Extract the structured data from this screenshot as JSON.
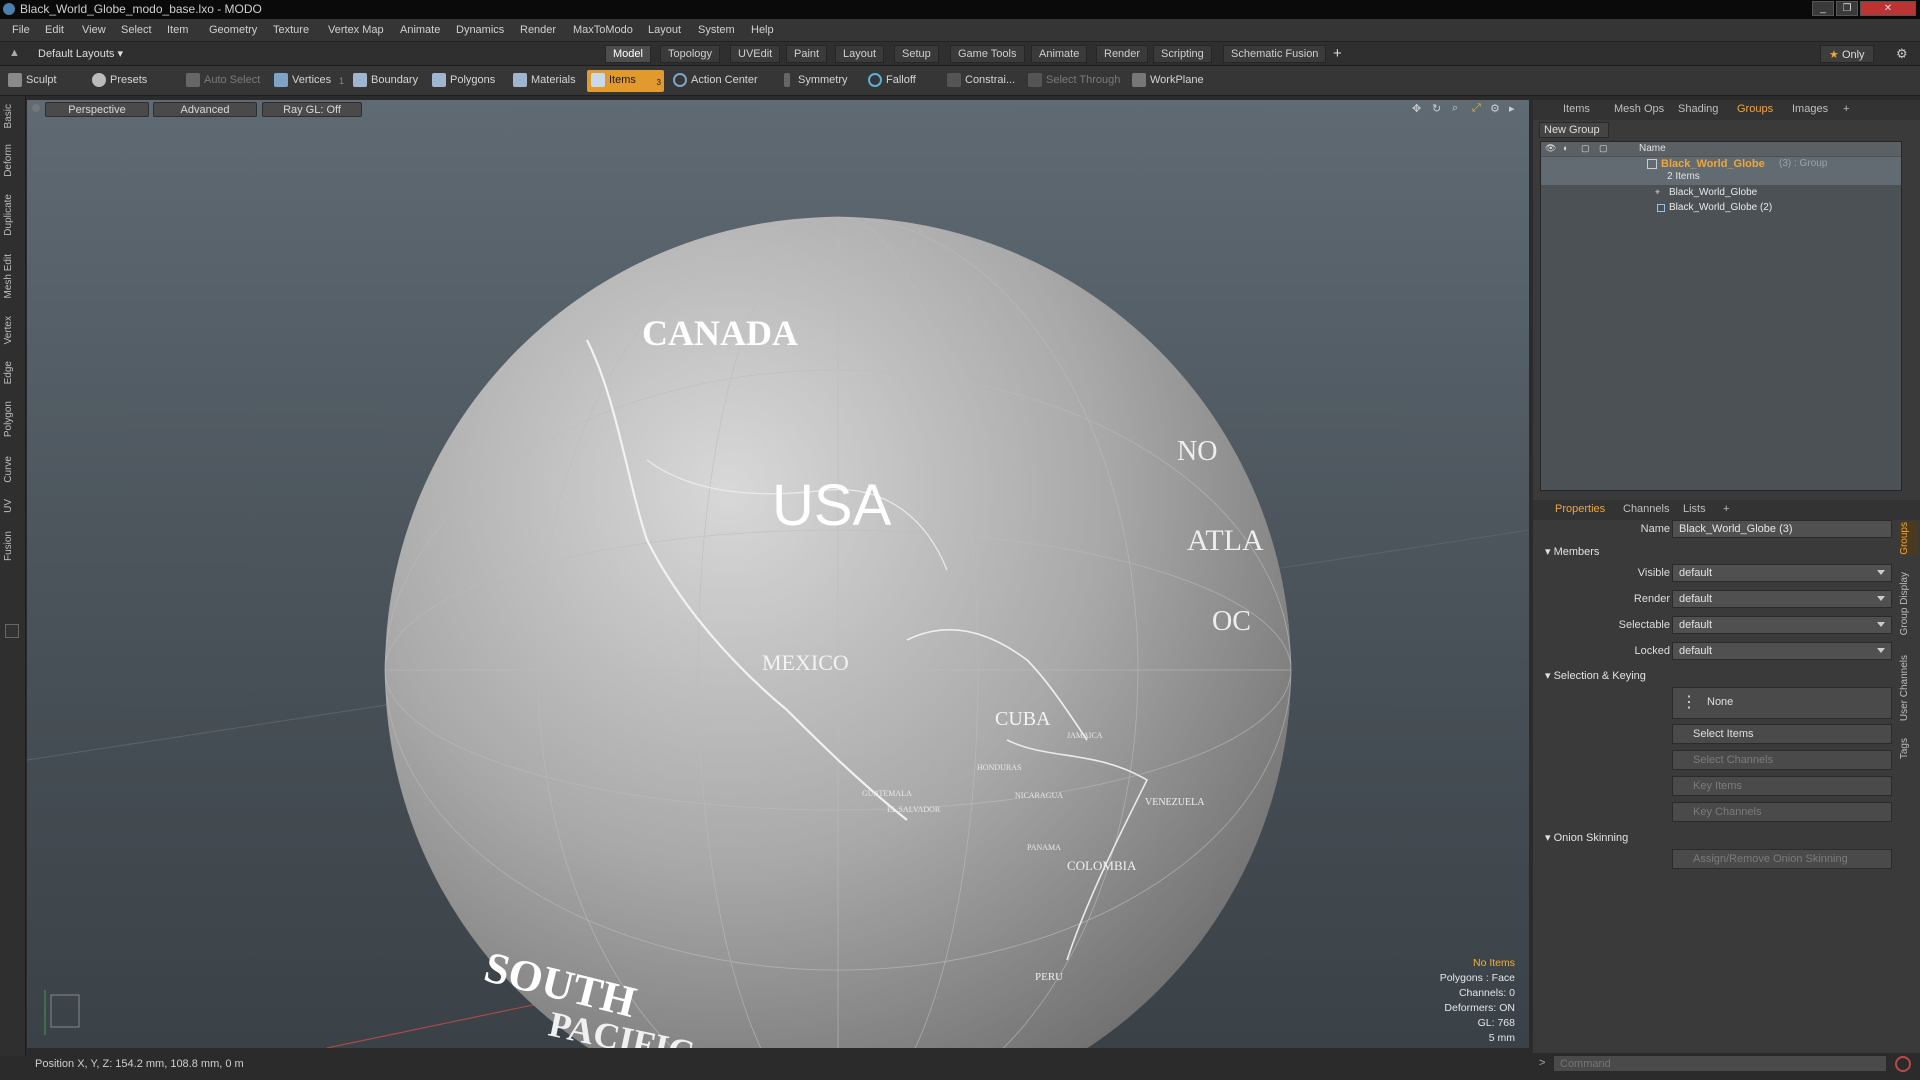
{
  "window": {
    "title": "Black_World_Globe_modo_base.lxo - MODO"
  },
  "menu": [
    "File",
    "Edit",
    "View",
    "Select",
    "Item",
    "Geometry",
    "Texture",
    "Vertex Map",
    "Animate",
    "Dynamics",
    "Render",
    "MaxToModo",
    "Layout",
    "System",
    "Help"
  ],
  "layout_selector": "Default Layouts",
  "layout_tabs": [
    "Model",
    "Topology",
    "UVEdit",
    "Paint",
    "Layout",
    "Setup",
    "Game Tools",
    "Animate",
    "Render",
    "Scripting",
    "Schematic Fusion"
  ],
  "layout_only": "Only",
  "toolbar": {
    "sculpt": "Sculpt",
    "presets": "Presets",
    "auto_select": "Auto Select",
    "vertices": "Vertices",
    "vert_count": "1",
    "boundary": "Boundary",
    "polygons": "Polygons",
    "materials": "Materials",
    "items": "Items",
    "items_count": "3",
    "action_center": "Action Center",
    "symmetry": "Symmetry",
    "falloff": "Falloff",
    "constraints": "Constrai...",
    "select_through": "Select Through",
    "workplane": "WorkPlane"
  },
  "left_tabs": [
    "Basic",
    "Deform",
    "Duplicate",
    "Mesh Edit",
    "Vertex",
    "Edge",
    "Polygon",
    "Curve",
    "UV",
    "Fusion"
  ],
  "viewport": {
    "view": "Perspective",
    "shading": "Advanced",
    "raygl": "Ray GL: Off",
    "labels": {
      "canada": "CANADA",
      "usa": "USA",
      "mexico": "MEXICO",
      "cuba": "CUBA",
      "south": "SOUTH",
      "colombia": "COLOMBIA",
      "honduras": "HONDURAS",
      "guatemala": "GUATEMALA",
      "el_salvador": "EL SALVADOR",
      "nicaragua": "NICARAGUA",
      "panama": "PANAMA",
      "venezuela": "VENEZUELA",
      "peru": "PERU",
      "pacific": "PACIFIC",
      "jamaica": "JAMAICA",
      "atlantic": "ATLA",
      "north": "NO",
      "oc": "OC"
    },
    "hud": {
      "selection": "No Items",
      "polygons": "Polygons : Face",
      "channels": "Channels: 0",
      "deformers": "Deformers: ON",
      "gl": "GL: 768",
      "unit": "5 mm"
    }
  },
  "status": {
    "position": "Position X, Y, Z:  154.2 mm, 108.8 mm, 0 m"
  },
  "right_top_tabs": [
    "Items",
    "Mesh Ops",
    "Shading",
    "Groups",
    "Images"
  ],
  "new_group": "New Group",
  "tree": {
    "header": "Name",
    "group_name": "Black_World_Globe",
    "group_suffix": "(3) : Group",
    "group_count": "2 Items",
    "children": [
      "Black_World_Globe",
      "Black_World_Globe (2)"
    ]
  },
  "props_tabs": [
    "Properties",
    "Channels",
    "Lists"
  ],
  "props": {
    "name_label": "Name",
    "name_value": "Black_World_Globe (3)",
    "members": "Members",
    "visible_label": "Visible",
    "visible_value": "default",
    "render_label": "Render",
    "render_value": "default",
    "selectable_label": "Selectable",
    "selectable_value": "default",
    "locked_label": "Locked",
    "locked_value": "default",
    "sel_keying": "Selection & Keying",
    "none_label": "None",
    "select_items": "Select Items",
    "select_channels": "Select Channels",
    "key_items": "Key Items",
    "key_channels": "Key Channels",
    "onion": "Onion Skinning",
    "assign_onion": "Assign/Remove Onion Skinning"
  },
  "right_vtabs": [
    "Groups",
    "Group Display",
    "User Channels",
    "Tags"
  ],
  "command_placeholder": "Command",
  "colors": {
    "accent": "#e39a2c",
    "group_name": "#f0a63a"
  }
}
